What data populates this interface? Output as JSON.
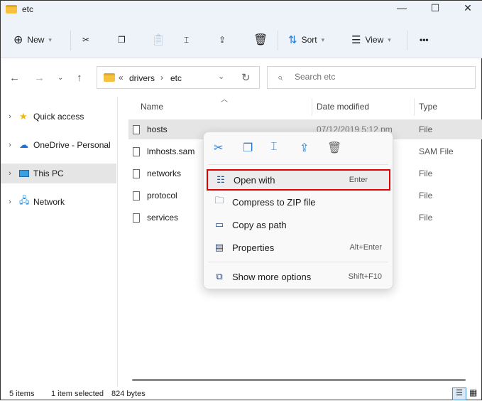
{
  "window": {
    "title": "etc",
    "minimize": "—",
    "maximize": "☐",
    "close": "✕"
  },
  "toolbar": {
    "new": "New",
    "sort": "Sort",
    "view": "View",
    "more": "•••"
  },
  "address": {
    "prefix": "«",
    "crumbs": [
      "drivers",
      "etc"
    ],
    "sep": "›"
  },
  "search": {
    "placeholder": "Search etc"
  },
  "sidebar": {
    "items": [
      {
        "label": "Quick access"
      },
      {
        "label": "OneDrive - Personal"
      },
      {
        "label": "This PC"
      },
      {
        "label": "Network"
      }
    ]
  },
  "columns": {
    "name": "Name",
    "date": "Date modified",
    "type": "Type"
  },
  "files": [
    {
      "name": "hosts",
      "date": "07/12/2019 5:12 pm",
      "type": "File"
    },
    {
      "name": "lmhosts.sam",
      "type": "SAM File"
    },
    {
      "name": "networks",
      "type": "File"
    },
    {
      "name": "protocol",
      "type": "File"
    },
    {
      "name": "services",
      "type": "File"
    }
  ],
  "context_menu": {
    "items": [
      {
        "label": "Open with",
        "shortcut": "Enter"
      },
      {
        "label": "Compress to ZIP file",
        "shortcut": ""
      },
      {
        "label": "Copy as path",
        "shortcut": ""
      },
      {
        "label": "Properties",
        "shortcut": "Alt+Enter"
      },
      {
        "label": "Show more options",
        "shortcut": "Shift+F10"
      }
    ],
    "highlight_color": "#e00000"
  },
  "status": {
    "count": "5 items",
    "selected": "1 item selected",
    "size": "824 bytes"
  }
}
